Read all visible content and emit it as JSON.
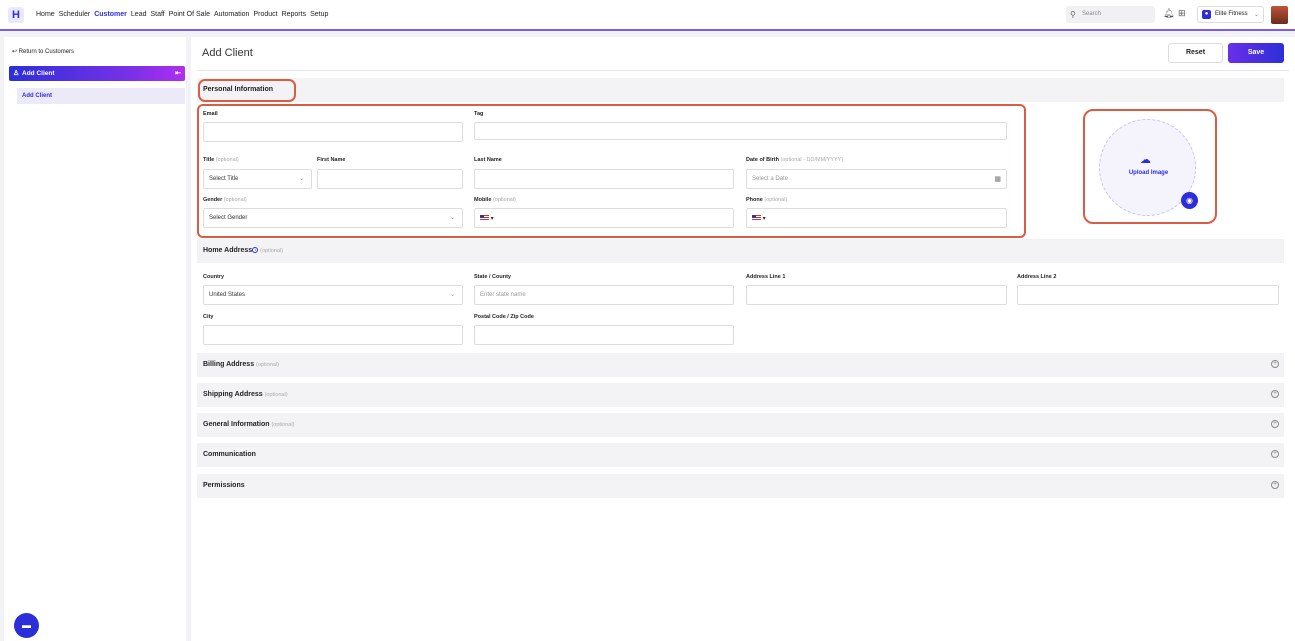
{
  "topnav": {
    "logo": "H",
    "items": [
      "Home",
      "Scheduler",
      "Customer",
      "Lead",
      "Staff",
      "Point Of Sale",
      "Automation",
      "Product",
      "Reports",
      "Setup"
    ],
    "active": "Customer",
    "search_placeholder": "Search",
    "location": "Elite Fitness"
  },
  "sidebar": {
    "back_label": "Return to Customers",
    "header": "Add Client",
    "item": "Add Client"
  },
  "main": {
    "title": "Add Client",
    "reset_label": "Reset",
    "save_label": "Save"
  },
  "personal": {
    "section": "Personal Information",
    "email_label": "Email",
    "tag_label": "Tag",
    "title_label": "Title",
    "title_opt": "(optional)",
    "title_value": "Select Title",
    "first_label": "First Name",
    "last_label": "Last Name",
    "dob_label": "Date of Birth",
    "dob_opt": "(optional - DD/MM/YYYY)",
    "dob_placeholder": "Select a Date",
    "gender_label": "Gender",
    "gender_opt": "(optional)",
    "gender_value": "Select Gender",
    "mobile_label": "Mobile",
    "mobile_opt": "(optional)",
    "phone_label": "Phone",
    "phone_opt": "(optional)",
    "upload_label": "Upload Image"
  },
  "home_address": {
    "section": "Home Address",
    "opt": "(optional)",
    "country_label": "Country",
    "country_value": "United States",
    "state_label": "State / County",
    "state_placeholder": "Enter state name",
    "addr1_label": "Address Line 1",
    "addr2_label": "Address Line 2",
    "city_label": "City",
    "postal_label": "Postal Code / Zip Code"
  },
  "collapsed_sections": [
    {
      "title": "Billing Address",
      "opt": "(optional)"
    },
    {
      "title": "Shipping Address",
      "opt": "(optional)"
    },
    {
      "title": "General Information",
      "opt": "(optional)"
    },
    {
      "title": "Communication",
      "opt": ""
    },
    {
      "title": "Permissions",
      "opt": ""
    }
  ],
  "colors": {
    "accent": "#2c2fd9",
    "highlight": "#d95c45"
  }
}
